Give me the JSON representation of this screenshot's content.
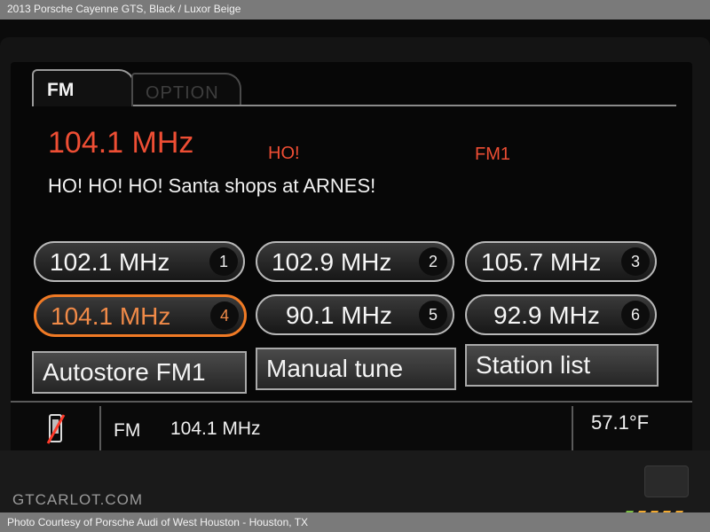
{
  "page": {
    "title": "2013 Porsche Cayenne GTS,  Black / Luxor Beige",
    "photo_credit": "Photo Courtesy of Porsche Audi of West Houston - Houston, TX",
    "watermark": "GTCARLOT.COM"
  },
  "tabs": [
    {
      "label": "FM",
      "selected": true
    },
    {
      "label": "OPTION",
      "selected": false
    }
  ],
  "now_playing": {
    "frequency": "104.1 MHz",
    "station_name": "HO!",
    "band": "FM1",
    "radiotext": "HO!  HO!  HO!  Santa shops at ARNES!"
  },
  "presets": [
    {
      "frequency": "102.1 MHz",
      "number": "1",
      "active": false
    },
    {
      "frequency": "102.9 MHz",
      "number": "2",
      "active": false
    },
    {
      "frequency": "105.7 MHz",
      "number": "3",
      "active": false
    },
    {
      "frequency": "104.1 MHz",
      "number": "4",
      "active": true
    },
    {
      "frequency": "90.1 MHz",
      "number": "5",
      "active": false
    },
    {
      "frequency": "92.9 MHz",
      "number": "6",
      "active": false
    }
  ],
  "actions": [
    {
      "label": "Autostore FM1"
    },
    {
      "label": "Manual tune"
    },
    {
      "label": "Station list"
    }
  ],
  "status_bar": {
    "icon": "phone-muted-icon",
    "band": "FM",
    "frequency": "104.1 MHz",
    "temperature": "57.1°F"
  },
  "colors": {
    "accent_red": "#ee4e34",
    "active_orange": "#f07a25"
  }
}
